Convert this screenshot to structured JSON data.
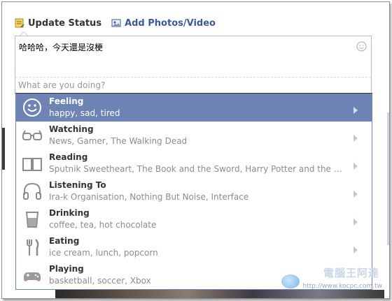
{
  "tabs": {
    "update_status": "Update Status",
    "add_photos": "Add Photos/Video"
  },
  "composer": {
    "text": "哈哈哈，今天還是沒梗",
    "placeholder": "What are you doing?"
  },
  "menu": {
    "items": [
      {
        "label": "Feeling",
        "sub": "happy, sad, tired",
        "icon": "smiley-icon",
        "active": true
      },
      {
        "label": "Watching",
        "sub": "News, Gamer, The Walking Dead",
        "icon": "glasses-icon"
      },
      {
        "label": "Reading",
        "sub": "Sputnik Sweetheart, The Book and the Sword, Harry Potter and the Goblet of Fire",
        "icon": "book-icon"
      },
      {
        "label": "Listening To",
        "sub": "Ira-k Organisation, Nothing But Noise, Interface",
        "icon": "headphones-icon"
      },
      {
        "label": "Drinking",
        "sub": "coffee, tea, hot chocolate",
        "icon": "cup-icon"
      },
      {
        "label": "Eating",
        "sub": "ice cream, lunch, popcorn",
        "icon": "fork-knife-icon"
      },
      {
        "label": "Playing",
        "sub": "basketball, soccer, Xbox",
        "icon": "gamepad-icon"
      }
    ]
  },
  "watermark": {
    "title": "電腦王阿達",
    "url": "http://www.kocpc.com.tw"
  },
  "colors": {
    "active_bg": "#6d84b4",
    "link": "#3b5998"
  }
}
